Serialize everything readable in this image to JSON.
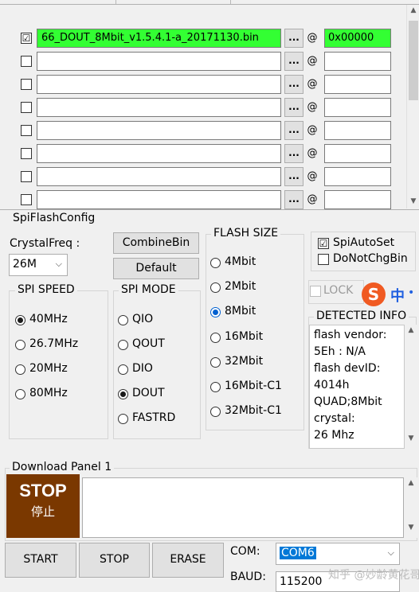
{
  "files": [
    {
      "checked": true,
      "check_glyph": "☑",
      "path": "66_DOUT_8Mbit_v1.5.4.1-a_20171130.bin",
      "browse": "...",
      "at": "@",
      "address": "0x00000"
    },
    {
      "checked": false,
      "check_glyph": "",
      "path": "",
      "browse": "...",
      "at": "@",
      "address": ""
    },
    {
      "checked": false,
      "check_glyph": "",
      "path": "",
      "browse": "...",
      "at": "@",
      "address": ""
    },
    {
      "checked": false,
      "check_glyph": "",
      "path": "",
      "browse": "...",
      "at": "@",
      "address": ""
    },
    {
      "checked": false,
      "check_glyph": "",
      "path": "",
      "browse": "...",
      "at": "@",
      "address": ""
    },
    {
      "checked": false,
      "check_glyph": "",
      "path": "",
      "browse": "...",
      "at": "@",
      "address": ""
    },
    {
      "checked": false,
      "check_glyph": "",
      "path": "",
      "browse": "...",
      "at": "@",
      "address": ""
    },
    {
      "checked": false,
      "check_glyph": "",
      "path": "",
      "browse": "...",
      "at": "@",
      "address": ""
    }
  ],
  "spiflash": {
    "title": "SpiFlashConfig",
    "crystal_label": "CrystalFreq :",
    "crystal_value": "26M",
    "combine_button": "CombineBin",
    "default_button": "Default",
    "spi_speed": {
      "title": "SPI SPEED",
      "options": [
        "40MHz",
        "26.7MHz",
        "20MHz",
        "80MHz"
      ],
      "selected": "40MHz"
    },
    "spi_mode": {
      "title": "SPI MODE",
      "options": [
        "QIO",
        "QOUT",
        "DIO",
        "DOUT",
        "FASTRD"
      ],
      "selected": "DOUT"
    },
    "flash_size": {
      "title": "FLASH SIZE",
      "options": [
        "4Mbit",
        "2Mbit",
        "8Mbit",
        "16Mbit",
        "32Mbit",
        "16Mbit-C1",
        "32Mbit-C1"
      ],
      "selected": "8Mbit"
    },
    "spi_auto_set": {
      "label": "SpiAutoSet",
      "checked": true,
      "glyph": "☑"
    },
    "do_not_chg_bin": {
      "label": "DoNotChgBin",
      "checked": false,
      "glyph": ""
    },
    "lock_label": "LOCK",
    "ime_badge": "S",
    "ime_text": "中",
    "detected_info": {
      "title": "DETECTED INFO",
      "lines": [
        "flash vendor:",
        "5Eh : N/A",
        "flash devID:",
        "4014h",
        "QUAD;8Mbit",
        "crystal:",
        "26 Mhz"
      ]
    }
  },
  "download": {
    "panel_title": "Download Panel 1",
    "status_big": "STOP",
    "status_small": "停止",
    "buttons": {
      "start": "START",
      "stop": "STOP",
      "erase": "ERASE"
    },
    "com_label": "COM:",
    "com_value": "COM6",
    "baud_label": "BAUD:",
    "baud_value": "115200",
    "watermark": "知乎 @妙龄黄花哥"
  },
  "colors": {
    "active_green": "#33ff33",
    "stop_brown": "#7a3800",
    "selection_blue": "#0078d7"
  }
}
